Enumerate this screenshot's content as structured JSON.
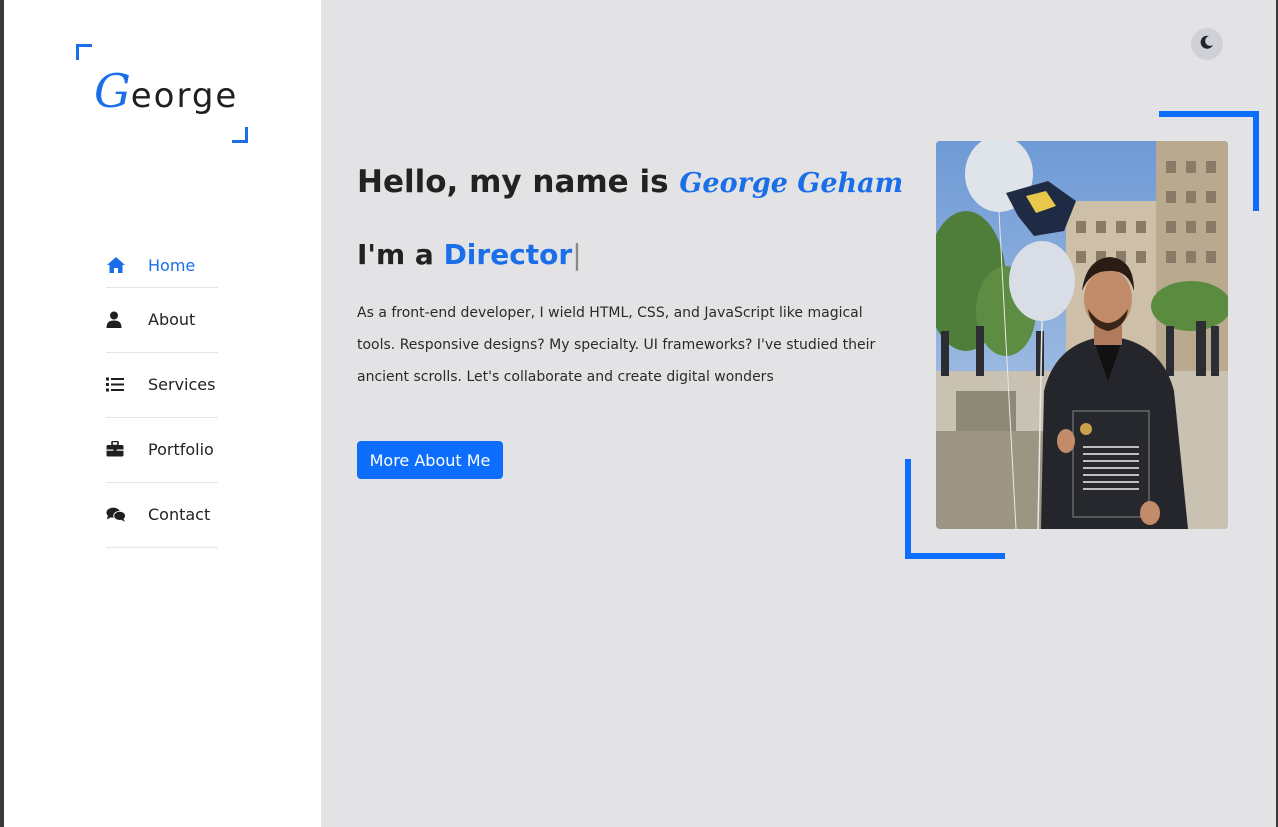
{
  "logo": {
    "initial": "G",
    "rest": "eorge"
  },
  "nav": {
    "items": [
      {
        "label": "Home",
        "icon": "home-icon",
        "active": true
      },
      {
        "label": "About",
        "icon": "user-icon",
        "active": false
      },
      {
        "label": "Services",
        "icon": "list-icon",
        "active": false
      },
      {
        "label": "Portfolio",
        "icon": "briefcase-icon",
        "active": false
      },
      {
        "label": "Contact",
        "icon": "comments-icon",
        "active": false
      }
    ]
  },
  "hero": {
    "greeting": "Hello, my name is ",
    "name": "George Geham",
    "role_prefix": "I'm a ",
    "role": "Director",
    "cursor": "|",
    "bio": "As a front-end developer, I wield HTML, CSS, and JavaScript like magical tools. Responsive designs? My specialty. UI frameworks? I've studied their ancient scrolls. Let's collaborate and create digital wonders",
    "button_label": "More About Me"
  },
  "theme_toggle": {
    "icon": "moon-icon"
  },
  "colors": {
    "accent": "#0d6efd",
    "sidebar_bg": "#ffffff",
    "main_bg": "#e3e3e6"
  }
}
